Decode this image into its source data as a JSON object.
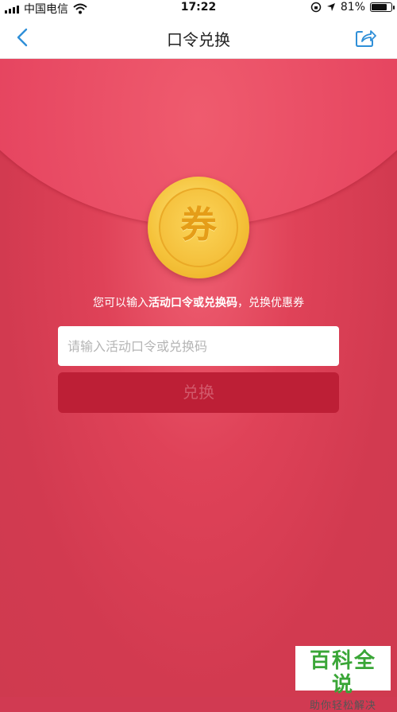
{
  "status_bar": {
    "carrier": "中国电信",
    "time": "17:22",
    "battery_percent": "81%",
    "battery_level": 0.81
  },
  "nav": {
    "title": "口令兑换",
    "back_icon": "chevron-left-icon",
    "share_icon": "share-icon"
  },
  "coin": {
    "glyph": "券"
  },
  "hint": {
    "prefix": "您可以输入",
    "bold": "活动口令或兑换码",
    "suffix": "，兑换优惠券"
  },
  "input": {
    "placeholder": "请输入活动口令或兑换码",
    "value": ""
  },
  "redeem_button": {
    "label": "兑换"
  },
  "watermark": {
    "title": "百科全说",
    "subtitle": "助你轻松解决"
  },
  "colors": {
    "accent": "#2f8fd8",
    "background": "#d13a52",
    "button": "#bd1f36",
    "coin": "#f5c33b"
  }
}
